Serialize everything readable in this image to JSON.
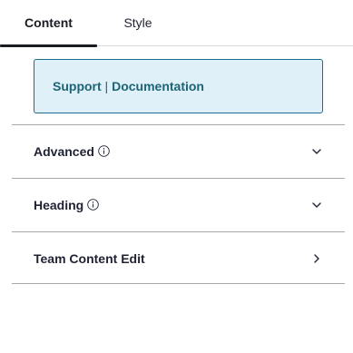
{
  "tabs": [
    {
      "label": "Content",
      "active": true
    },
    {
      "label": "Style",
      "active": false
    }
  ],
  "support": {
    "link1": "Support",
    "separator": "|",
    "link2": "Documentation"
  },
  "sections": [
    {
      "label": "Advanced",
      "has_info": true,
      "chevron": "chevron-down-icon"
    },
    {
      "label": "Heading",
      "has_info": true,
      "chevron": "chevron-down-icon"
    },
    {
      "label": "Team Content Edit",
      "has_info": false,
      "chevron": "chevron-right-icon"
    }
  ],
  "colors": {
    "accent": "#1c6476",
    "support_bg": "#dff0f8",
    "support_border": "#1f6d91",
    "text": "#1f2233",
    "divider": "#a9aab0"
  }
}
